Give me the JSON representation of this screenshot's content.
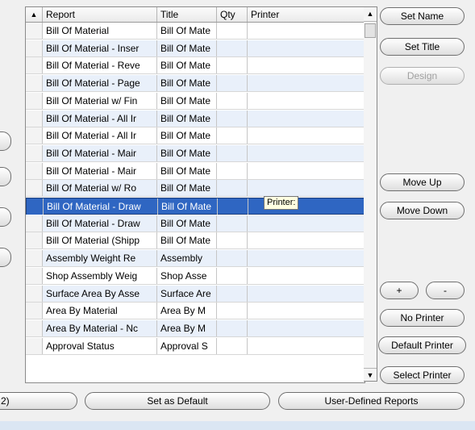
{
  "grid": {
    "columns": [
      "Report",
      "Title",
      "Qty",
      "Printer"
    ],
    "rows": [
      {
        "report": "Bill Of Material",
        "title": "Bill Of Mate",
        "qty": "",
        "printer": ""
      },
      {
        "report": "Bill Of Material - Inser",
        "title": "Bill Of Mate",
        "qty": "",
        "printer": ""
      },
      {
        "report": "Bill Of Material - Reve",
        "title": "Bill Of Mate",
        "qty": "",
        "printer": ""
      },
      {
        "report": "Bill Of Material - Page",
        "title": "Bill Of Mate",
        "qty": "",
        "printer": ""
      },
      {
        "report": "Bill Of Material w/ Fin",
        "title": "Bill Of Mate",
        "qty": "",
        "printer": ""
      },
      {
        "report": "Bill Of Material - All Ir",
        "title": "Bill Of Mate",
        "qty": "",
        "printer": ""
      },
      {
        "report": "Bill Of Material - All Ir",
        "title": "Bill Of Mate",
        "qty": "",
        "printer": ""
      },
      {
        "report": "Bill Of Material - Mair",
        "title": "Bill Of Mate",
        "qty": "",
        "printer": ""
      },
      {
        "report": "Bill Of Material - Mair",
        "title": "Bill Of Mate",
        "qty": "",
        "printer": ""
      },
      {
        "report": "Bill Of Material w/ Ro",
        "title": "Bill Of Mate",
        "qty": "",
        "printer": ""
      },
      {
        "report": "Bill Of Material - Draw",
        "title": "Bill Of Mate",
        "qty": "",
        "printer": "",
        "selected": true
      },
      {
        "report": "Bill Of Material - Draw",
        "title": "Bill Of Mate",
        "qty": "",
        "printer": ""
      },
      {
        "report": "Bill Of Material (Shipp",
        "title": "Bill Of Mate",
        "qty": "",
        "printer": ""
      },
      {
        "report": "Assembly Weight Re",
        "title": "Assembly",
        "qty": "",
        "printer": ""
      },
      {
        "report": "Shop Assembly Weig",
        "title": "Shop Asse",
        "qty": "",
        "printer": ""
      },
      {
        "report": "Surface Area By Asse",
        "title": "Surface Are",
        "qty": "",
        "printer": ""
      },
      {
        "report": "Area By Material",
        "title": "Area By M",
        "qty": "",
        "printer": ""
      },
      {
        "report": "Area By Material - Nc",
        "title": "Area By M",
        "qty": "",
        "printer": ""
      },
      {
        "report": "Approval Status",
        "title": "Approval S",
        "qty": "",
        "printer": ""
      }
    ],
    "sort_icon": "sort-up-triangle",
    "tooltip": "Printer:"
  },
  "scrollbar": {
    "up_icon": "▲",
    "down_icon": "▼"
  },
  "side_buttons": {
    "set_name": "Set Name",
    "set_title": "Set Title",
    "design": "Design",
    "move_up": "Move Up",
    "move_down": "Move Down",
    "plus": "+",
    "minus": "-",
    "no_printer": "No Printer",
    "default_printer": "Default Printer",
    "select_printer": "Select Printer"
  },
  "bottom_buttons": {
    "left_partial": "2)",
    "set_default": "Set as Default",
    "user_defined": "User-Defined Reports"
  }
}
